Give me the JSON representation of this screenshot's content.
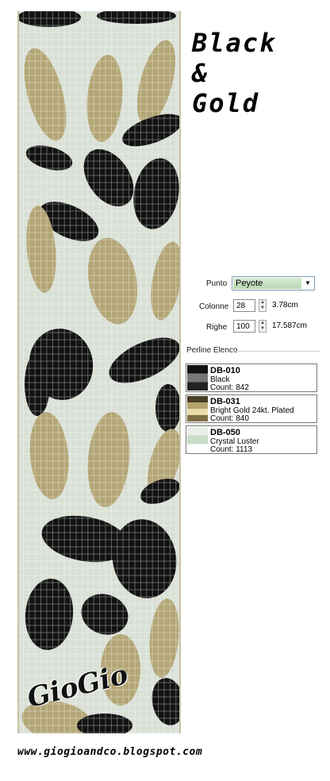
{
  "title": {
    "line1": "Black",
    "line2": "&",
    "line3": "Gold"
  },
  "settings": {
    "stitch_label": "Punto",
    "stitch_value": "Peyote",
    "columns_label": "Colonne",
    "columns_value": "28",
    "width_text": "3.78cm",
    "rows_label": "Righe",
    "rows_value": "100",
    "length_text": "17.587cm"
  },
  "bead_list": {
    "title": "Perline Elenco",
    "items": [
      {
        "code": "DB-010",
        "name": "Black",
        "count": "Count: 842",
        "colors": [
          "#111111",
          "#777777",
          "#222222"
        ]
      },
      {
        "code": "DB-031",
        "name": "Bright Gold 24kt. Plated",
        "count": "Count: 840",
        "colors": [
          "#4a3f25",
          "#b5a36e",
          "#e8dca8",
          "#7d6e45"
        ]
      },
      {
        "code": "DB-050",
        "name": "Crystal Luster",
        "count": "Count: 1113",
        "colors": [
          "#e9efe8",
          "#c9dcc7",
          "#ffffff"
        ]
      }
    ]
  },
  "colors": {
    "black_bead": "#121212",
    "gold_bead": "#b3a676",
    "crystal_bead": "#d9e0d6"
  },
  "signature": "GioGio",
  "website": "www.giogioandco.blogspot.com"
}
